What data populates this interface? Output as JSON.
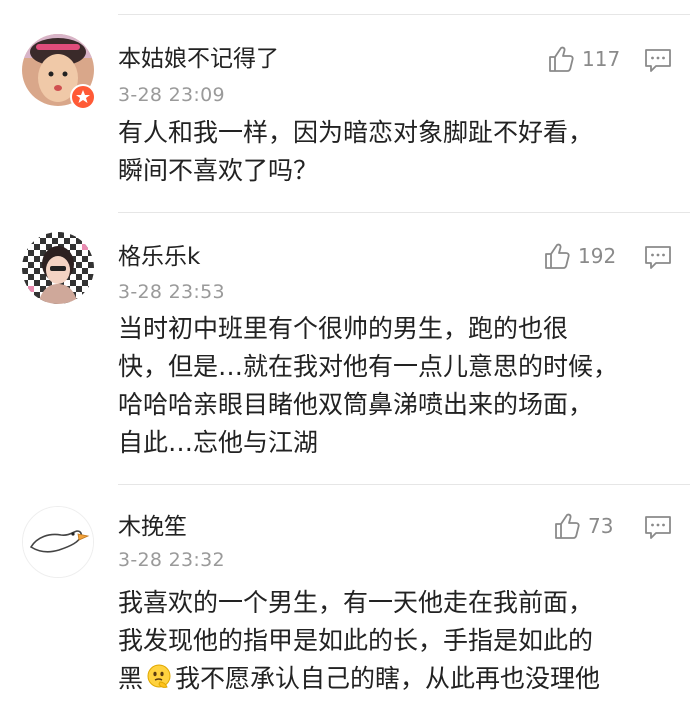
{
  "comments": [
    {
      "username": "本姑娘不记得了",
      "time": "3-28 23:09",
      "likes": "117",
      "lines": [
        "有人和我一样，因为暗恋对象脚趾不好看，",
        "瞬间不喜欢了吗？"
      ],
      "avatar_icon": "girl-avatar-icon",
      "badge_icon": "vip-badge-icon"
    },
    {
      "username": "格乐乐k",
      "time": "3-28 23:53",
      "likes": "192",
      "lines": [
        "当时初中班里有个很帅的男生，跑的也很",
        "快，但是…就在我对他有一点儿意思的时候，",
        "哈哈哈亲眼目睹他双筒鼻涕喷出来的场面，",
        "自此…忘他与江湖"
      ],
      "avatar_icon": "checkered-avatar-icon"
    },
    {
      "username": "木挽笙",
      "time": "3-28 23:32",
      "likes": "73",
      "lines": [
        "我喜欢的一个男生，有一天他走在我前面，",
        "我发现他的指甲是如此的长，手指是如此的"
      ],
      "line3_before_emoji": "黑",
      "line3_after_emoji": "我不愿承认自己的瞎，从此再也没理他",
      "avatar_icon": "goose-avatar-icon",
      "emoji_icon": "thinking-emoji-icon"
    }
  ],
  "icons": {
    "like": "thumbs-up-icon",
    "reply": "comment-bubble-icon"
  },
  "colors": {
    "text": "#222222",
    "meta": "#9a9a9a",
    "icon": "#8a8a8a",
    "badge": "#ff5a36"
  }
}
